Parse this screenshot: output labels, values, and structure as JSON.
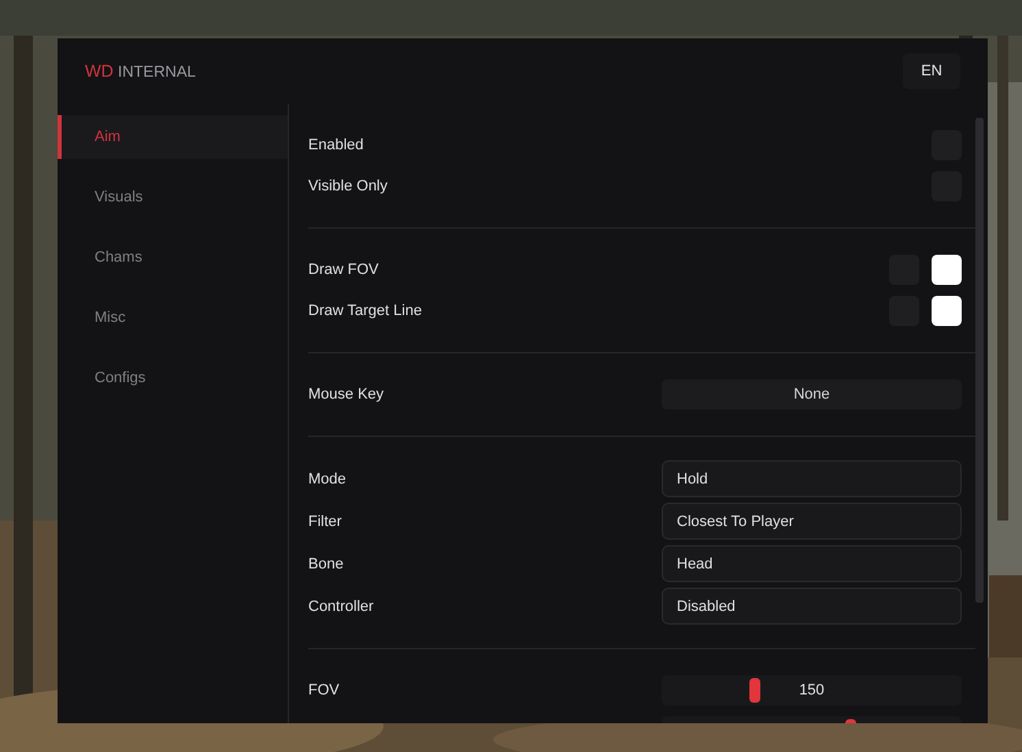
{
  "title": {
    "brand": "WD",
    "rest": "INTERNAL"
  },
  "language_button": "EN",
  "sidebar": {
    "items": [
      {
        "label": "Aim",
        "selected": true
      },
      {
        "label": "Visuals",
        "selected": false
      },
      {
        "label": "Chams",
        "selected": false
      },
      {
        "label": "Misc",
        "selected": false
      },
      {
        "label": "Configs",
        "selected": false
      }
    ]
  },
  "sections": [
    {
      "rows": [
        {
          "kind": "toggle",
          "label": "Enabled",
          "checked": false
        },
        {
          "kind": "toggle",
          "label": "Visible Only",
          "checked": false
        }
      ]
    },
    {
      "rows": [
        {
          "kind": "toggle",
          "label": "Draw FOV",
          "checked": false,
          "color": "#ffffff"
        },
        {
          "kind": "toggle",
          "label": "Draw Target Line",
          "checked": false,
          "color": "#ffffff"
        }
      ]
    },
    {
      "rows": [
        {
          "kind": "keybind",
          "label": "Mouse Key",
          "value": "None"
        }
      ]
    },
    {
      "rows": [
        {
          "kind": "select",
          "label": "Mode",
          "value": "Hold"
        },
        {
          "kind": "select",
          "label": "Filter",
          "value": "Closest To Player"
        },
        {
          "kind": "select",
          "label": "Bone",
          "value": "Head"
        },
        {
          "kind": "select",
          "label": "Controller",
          "value": "Disabled"
        }
      ]
    },
    {
      "rows": [
        {
          "kind": "slider",
          "label": "FOV",
          "value": "150",
          "level": 0.31
        },
        {
          "kind": "slider",
          "level": 0.63
        }
      ]
    }
  ]
}
